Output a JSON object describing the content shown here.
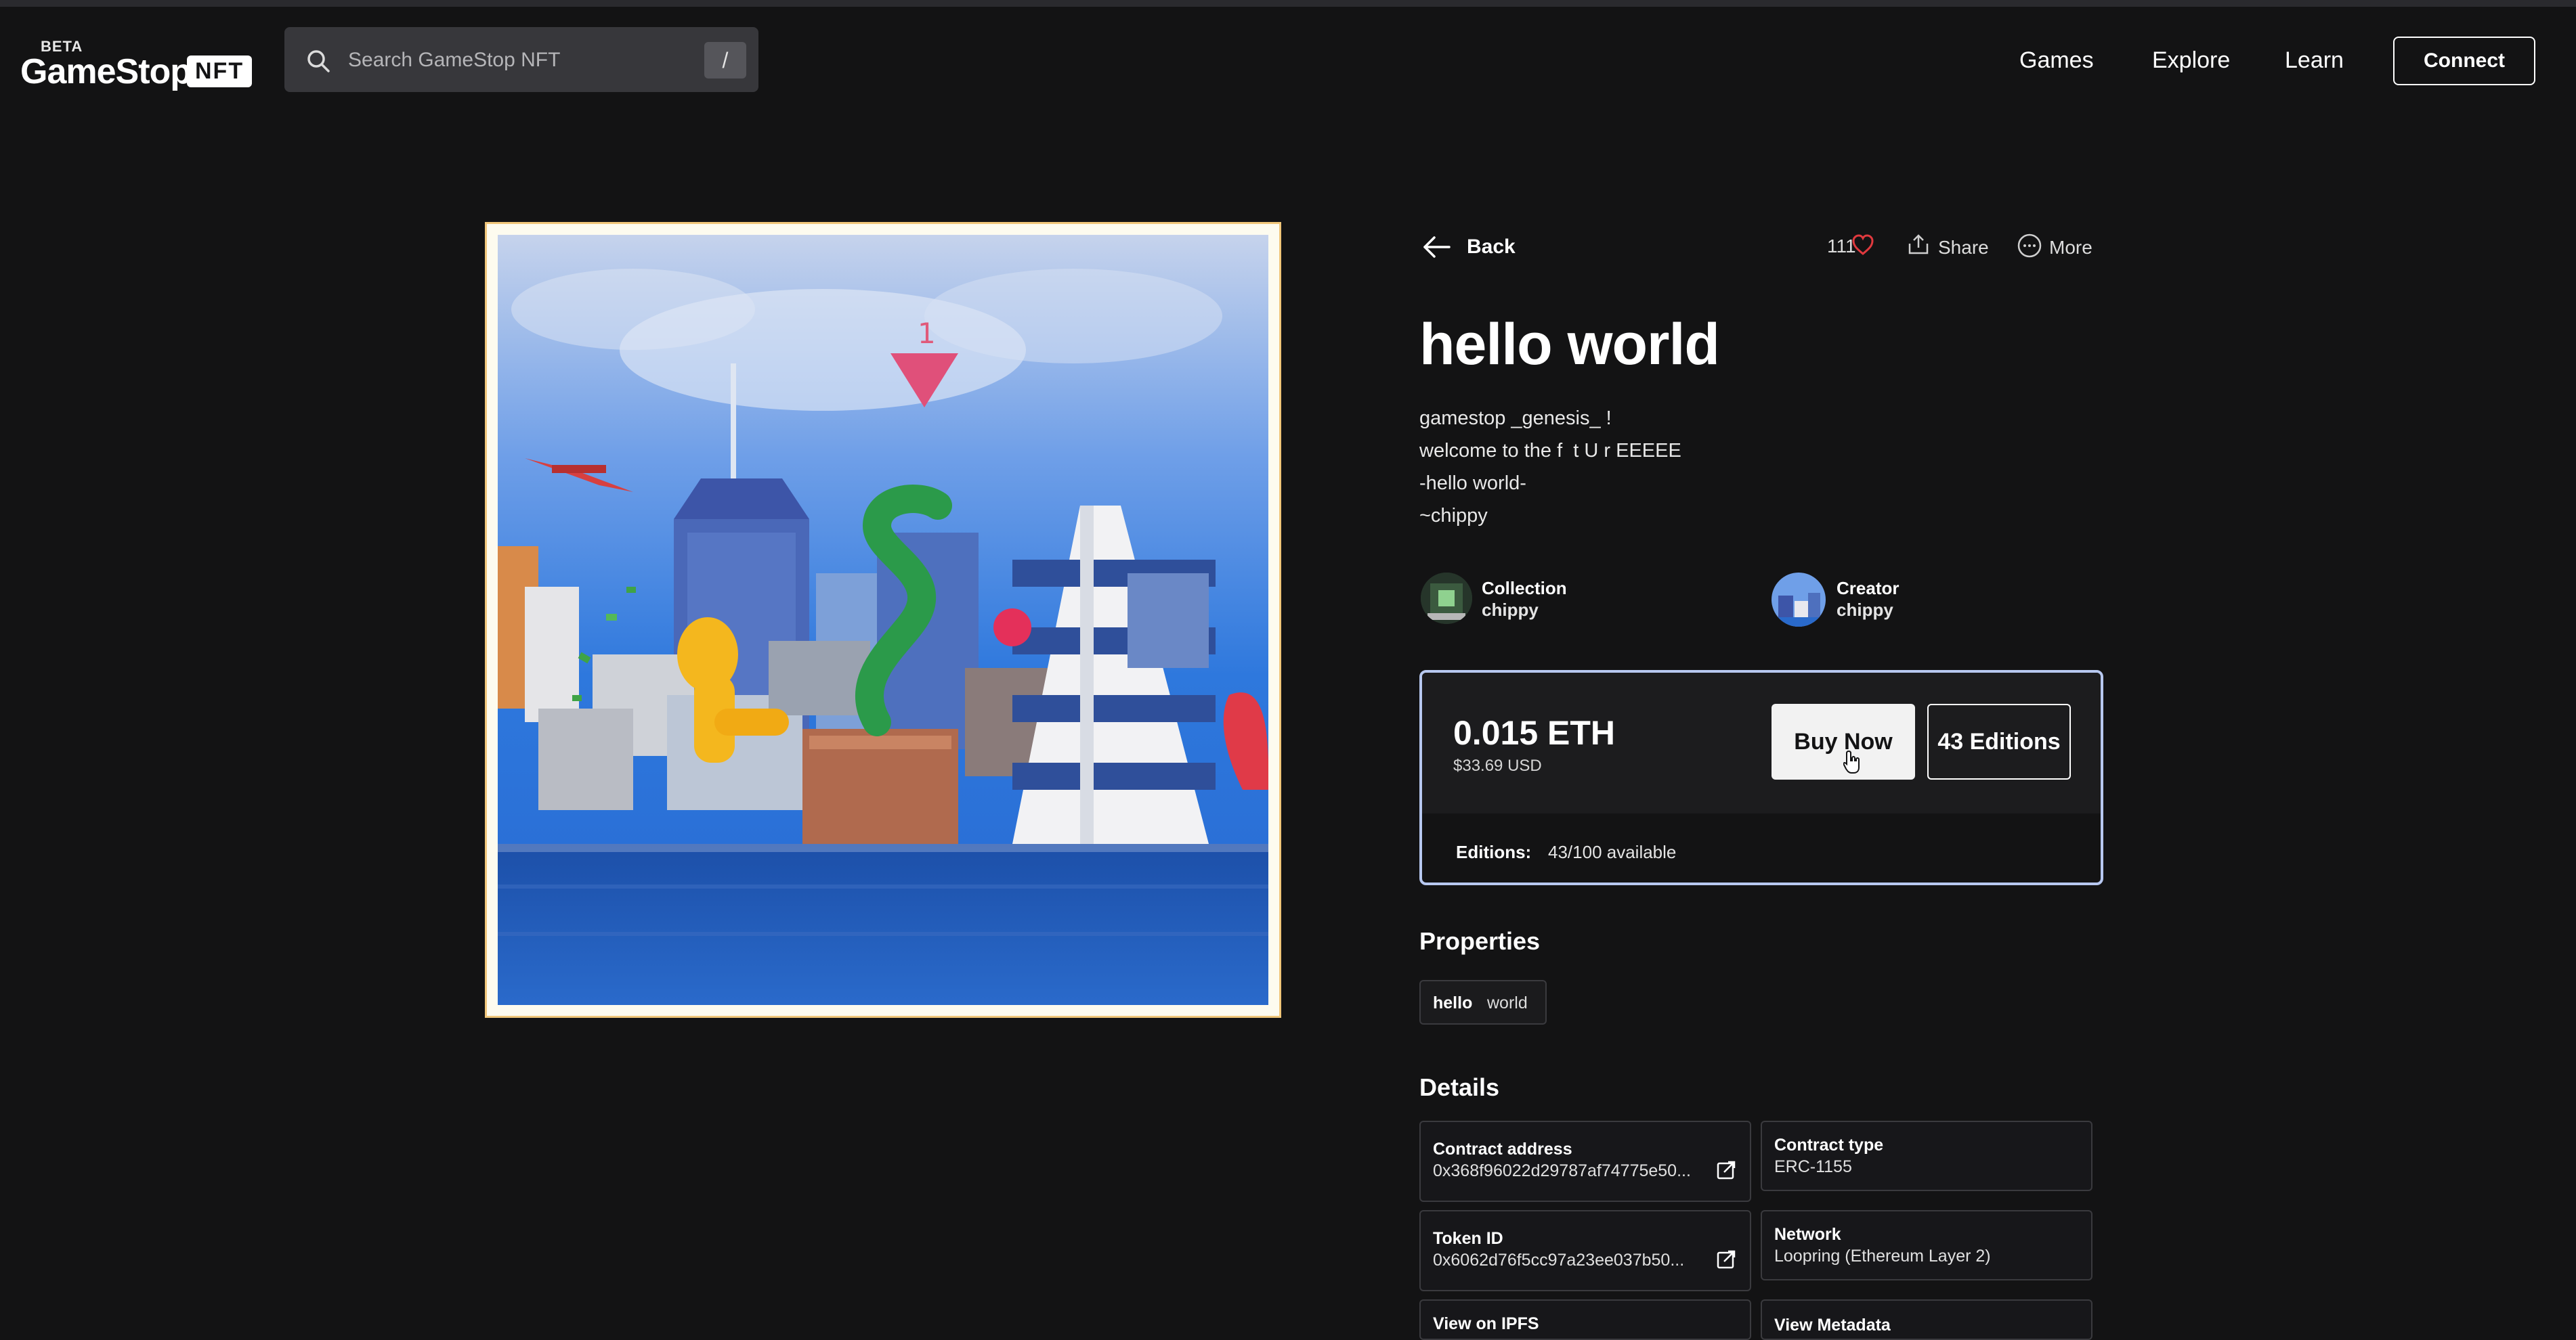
{
  "header": {
    "logo_beta": "BETA",
    "logo_text": "GameStop",
    "logo_badge": "NFT",
    "search_placeholder": "Search GameStop NFT",
    "search_shortcut": "/",
    "nav": [
      "Games",
      "Explore",
      "Learn"
    ],
    "connect_label": "Connect"
  },
  "item": {
    "back_label": "Back",
    "likes": "111",
    "share_label": "Share",
    "more_label": "More",
    "title": "hello world",
    "description": "gamestop _genesis_ !\nwelcome to the f  t U r EEEEE\n-hello world-\n~chippy",
    "collection_label": "Collection",
    "collection_value": "chippy",
    "creator_label": "Creator",
    "creator_value": "chippy",
    "artwork_number": "1"
  },
  "price": {
    "eth": "0.015 ETH",
    "usd": "$33.69 USD",
    "buy_label": "Buy Now",
    "editions_button": "43 Editions",
    "editions_label": "Editions:",
    "editions_value": "43/100 available"
  },
  "properties": {
    "heading": "Properties",
    "items": [
      {
        "key": "hello",
        "value": "world"
      }
    ]
  },
  "details": {
    "heading": "Details",
    "items": [
      {
        "label": "Contract address",
        "value": "0x368f96022d29787af74775e50..."
      },
      {
        "label": "Contract type",
        "value": "ERC-1155"
      },
      {
        "label": "Token ID",
        "value": "0x6062d76f5cc97a23ee037b50..."
      },
      {
        "label": "Network",
        "value": "Loopring (Ethereum Layer 2)"
      },
      {
        "label": "View on IPFS",
        "value": ""
      },
      {
        "label": "View Metadata",
        "value": ""
      }
    ]
  },
  "colors": {
    "background": "#131314",
    "search_bg": "#37373b",
    "heart": "#e0393e",
    "card_border": "#b7c8f0"
  }
}
